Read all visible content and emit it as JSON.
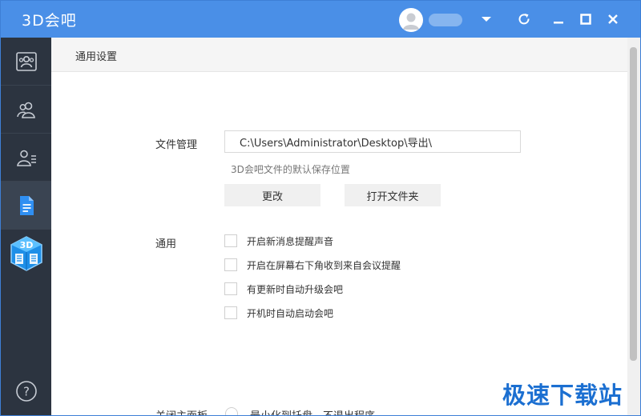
{
  "app": {
    "logo_text": "3D会吧"
  },
  "titlebar": {
    "icons": [
      "user-avatar",
      "chevron-down-icon",
      "refresh-icon",
      "minimize-icon",
      "maximize-icon",
      "close-icon"
    ]
  },
  "sidebar": {
    "items": [
      "meetings-icon",
      "contacts-icon",
      "user-list-icon",
      "document-icon",
      "3d-experience-logo"
    ],
    "bottom_icon": "help-icon",
    "active_index": 3
  },
  "content": {
    "section_title": "通用设置",
    "file_mgmt": {
      "label": "文件管理",
      "path": "C:\\Users\\Administrator\\Desktop\\导出\\",
      "hint": "3D会吧文件的默认保存位置",
      "change_button": "更改",
      "open_folder_button": "打开文件夹"
    },
    "general": {
      "label": "通用",
      "options": [
        "开启新消息提醒声音",
        "开启在屏幕右下角收到来自会议提醒",
        "有更新时自动升级会吧",
        "开机时自动启动会吧"
      ]
    },
    "close_panel": {
      "label": "关闭主面板",
      "option": "最小化到托盘，不退出程序"
    }
  },
  "watermark": "极速下载站",
  "colors": {
    "titlebar": "#4a8fe7",
    "sidebar": "#2c3440",
    "accent": "#2f8ff2"
  }
}
